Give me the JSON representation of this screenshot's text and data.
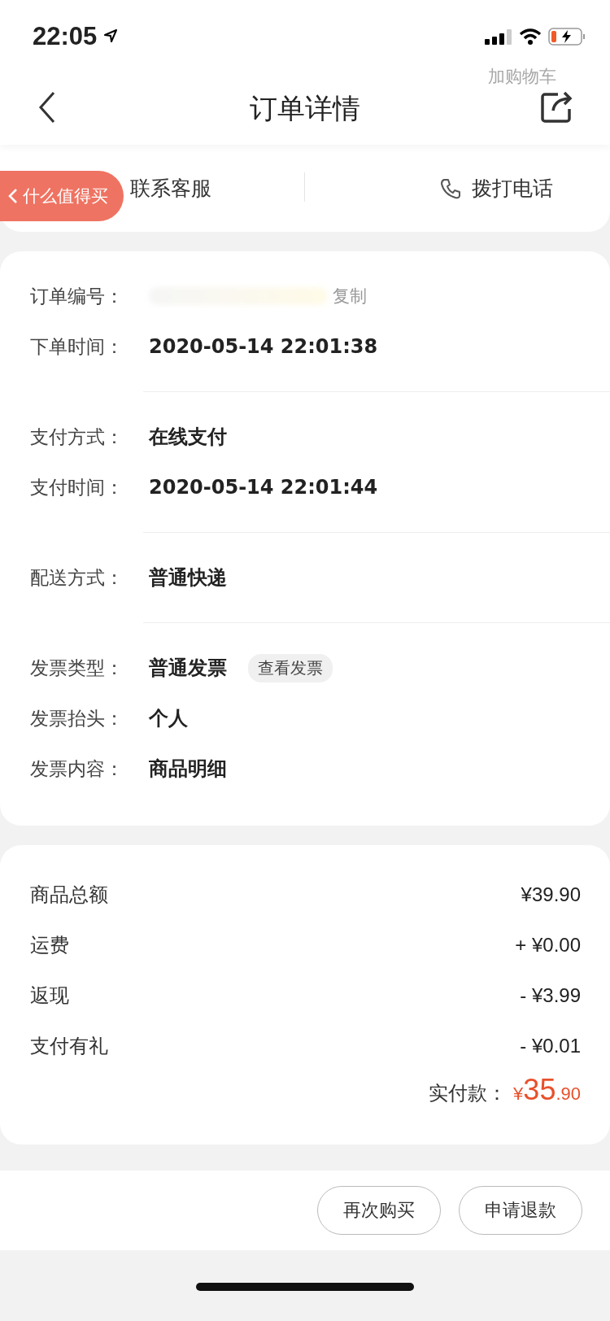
{
  "status_bar": {
    "time": "22:05"
  },
  "nav": {
    "title": "订单详情",
    "ghost_label": "加购物车"
  },
  "floating_tab": {
    "label": "什么值得买"
  },
  "contact": [
    {
      "kind": "chat",
      "label": "联系客服"
    },
    {
      "kind": "phone",
      "label": "拨打电话"
    }
  ],
  "info_groups": [
    {
      "rows": [
        {
          "kind": "order_number",
          "label": "订单编号：",
          "action": "复制"
        },
        {
          "kind": "text",
          "label": "下单时间：",
          "value": "2020-05-14 22:01:38"
        }
      ]
    },
    {
      "rows": [
        {
          "kind": "text",
          "label": "支付方式：",
          "value": "在线支付"
        },
        {
          "kind": "text",
          "label": "支付时间：",
          "value": "2020-05-14 22:01:44"
        }
      ]
    },
    {
      "rows": [
        {
          "kind": "text",
          "label": "配送方式：",
          "value": "普通快递"
        }
      ]
    },
    {
      "rows": [
        {
          "kind": "tagged",
          "label": "发票类型：",
          "value": "普通发票",
          "action": "查看发票"
        },
        {
          "kind": "text",
          "label": "发票抬头：",
          "value": "个人"
        },
        {
          "kind": "text",
          "label": "发票内容：",
          "value": "商品明细"
        }
      ]
    }
  ],
  "prices": [
    {
      "label": "商品总额",
      "value": "¥39.90"
    },
    {
      "label": "运费",
      "value": "+ ¥0.00"
    },
    {
      "label": "返现",
      "value": "- ¥3.99"
    },
    {
      "label": "支付有礼",
      "value": "- ¥0.01"
    }
  ],
  "total": {
    "label": "实付款：",
    "currency": "¥",
    "integer": "35",
    "decimal": ".90"
  },
  "buttons": [
    "再次购买",
    "申请退款"
  ]
}
